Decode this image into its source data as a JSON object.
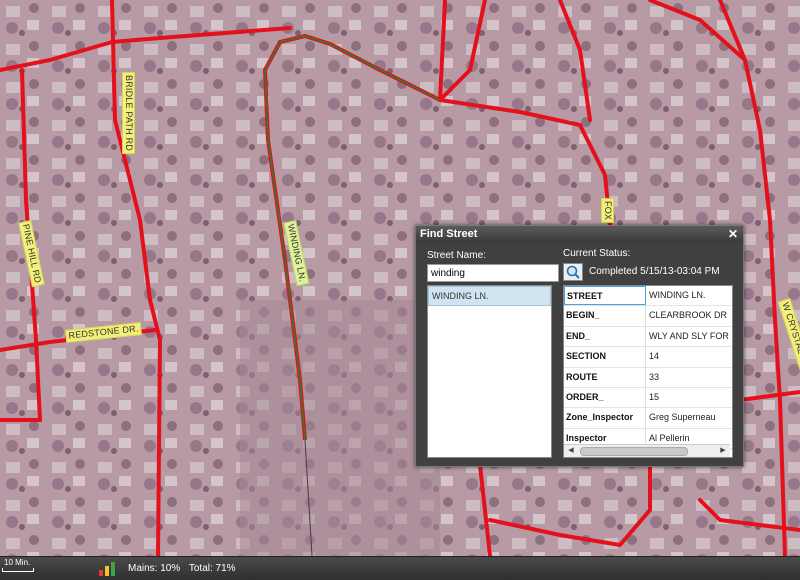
{
  "map": {
    "labels": {
      "bridle_path": "BRIDLE PATH RD",
      "pine_hill": "PINE HILL RD",
      "redstone": "REDSTONE DR.",
      "winding": "WINDING LN.",
      "fox": "FOX",
      "crystal_brook": "W CRYSTAL BROOK"
    },
    "colors": {
      "road": "#e4101c",
      "highlight": "#2e7d32",
      "aerial": "#b79aa4"
    }
  },
  "find_street": {
    "title": "Find Street",
    "close_glyph": "✕",
    "street_name_label": "Street Name:",
    "street_input_value": "winding",
    "results": [
      "WINDING LN."
    ],
    "current_status_label": "Current Status:",
    "status_text": "Completed 5/15/13-03:04 PM",
    "search_icon": "magnifier-icon",
    "attributes": [
      {
        "key": "STREET",
        "value": "WINDING LN."
      },
      {
        "key": "BEGIN_",
        "value": "CLEARBROOK DR"
      },
      {
        "key": "END_",
        "value": "WLY AND SLY FOR"
      },
      {
        "key": "SECTION",
        "value": "14"
      },
      {
        "key": "ROUTE",
        "value": "33"
      },
      {
        "key": "ORDER_",
        "value": "15"
      },
      {
        "key": "Zone_Inspector",
        "value": "Greg Superneau"
      },
      {
        "key": "Inspector",
        "value": "Al Pellerin"
      }
    ]
  },
  "status_bar": {
    "scale_label": "10 Min.",
    "mains": "Mains: 10%",
    "total": "Total: 71%",
    "icon": "bar-chart-icon"
  }
}
